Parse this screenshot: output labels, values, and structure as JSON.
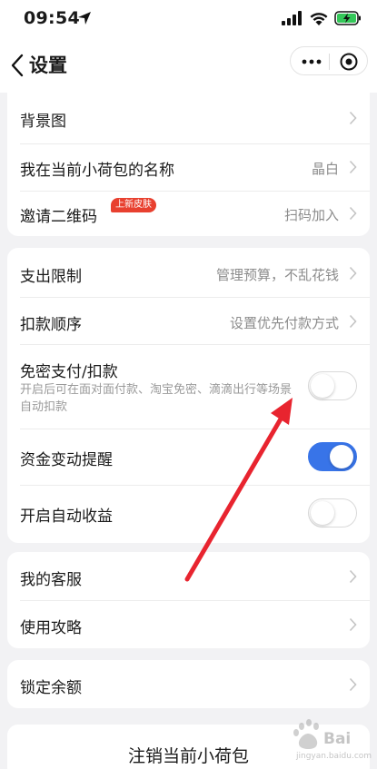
{
  "status_bar": {
    "time": "09:54"
  },
  "nav": {
    "title": "设置"
  },
  "group1": [
    {
      "label": "背景图",
      "value": ""
    },
    {
      "label": "我在当前小荷包的名称",
      "value": "晶白"
    },
    {
      "label": "邀请二维码",
      "badge": "上新皮肤",
      "value": "扫码加入"
    }
  ],
  "group2": {
    "limit": {
      "label": "支出限制",
      "value": "管理预算，不乱花钱"
    },
    "order": {
      "label": "扣款顺序",
      "value": "设置优先付款方式"
    },
    "nopass": {
      "label": "免密支付/扣款",
      "desc": "开启后可在面对面付款、淘宝免密、滴滴出行等场景自动扣款",
      "on": false
    },
    "notify": {
      "label": "资金变动提醒",
      "on": true
    },
    "auto_earn": {
      "label": "开启自动收益",
      "on": false
    }
  },
  "group3": [
    {
      "label": "我的客服"
    },
    {
      "label": "使用攻略"
    }
  ],
  "group4": {
    "lock": {
      "label": "锁定余额"
    }
  },
  "logout": {
    "label": "注销当前小荷包"
  },
  "watermark": {
    "brand": "Bai",
    "site": "jingyan.baidu.com"
  },
  "colors": {
    "accent": "#3874e8",
    "badge": "#e8402f",
    "annotation_arrow": "#e8242f",
    "background": "#f2f2f4"
  }
}
